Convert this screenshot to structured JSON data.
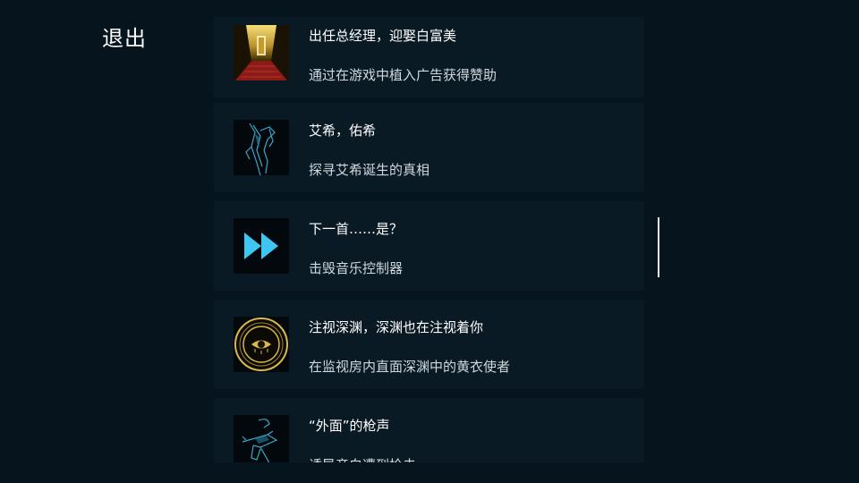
{
  "header": {
    "exit_label": "退出"
  },
  "achievements": [
    {
      "title": "出任总经理，迎娶白富美",
      "desc": "通过在游戏中植入广告获得赞助",
      "icon": "golden-corridor-icon"
    },
    {
      "title": "艾希，佑希",
      "desc": "探寻艾希诞生的真相",
      "icon": "blade-figure-icon"
    },
    {
      "title": "下一首……是？",
      "desc": "击毁音乐控制器",
      "icon": "fast-forward-icon"
    },
    {
      "title": "注视深渊，深渊也在注视着你",
      "desc": "在监视房内直面深渊中的黄衣使者",
      "icon": "eye-seal-icon"
    },
    {
      "title": "“外面”的枪声",
      "desc": "诱导帝白遭到枪击",
      "icon": "gun-hand-icon"
    }
  ],
  "colors": {
    "background": "#06141e",
    "card": "#0a1a24",
    "accent_cyan": "#3fc6f0",
    "accent_gold": "#d8b84a"
  }
}
